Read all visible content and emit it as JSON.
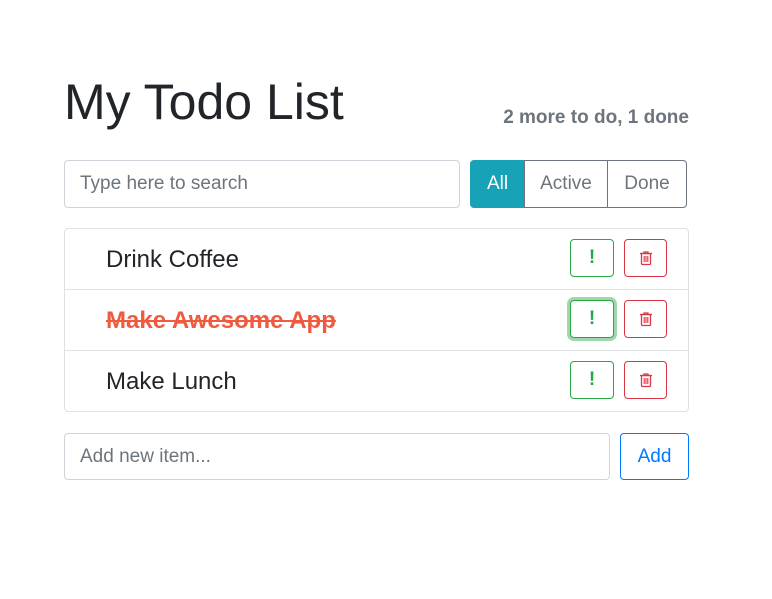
{
  "header": {
    "title": "My Todo List",
    "status": "2 more to do, 1 done"
  },
  "search": {
    "placeholder": "Type here to search",
    "value": ""
  },
  "filters": {
    "all": "All",
    "active": "Active",
    "done": "Done",
    "selected": "All"
  },
  "todos": [
    {
      "label": "Drink Coffee",
      "done": false,
      "important_label": "!",
      "delete_icon": "trash-icon"
    },
    {
      "label": "Make Awesome App",
      "done": true,
      "important_label": "!",
      "delete_icon": "trash-icon"
    },
    {
      "label": "Make Lunch",
      "done": false,
      "important_label": "!",
      "delete_icon": "trash-icon"
    }
  ],
  "add_form": {
    "placeholder": "Add new item...",
    "value": "",
    "button_label": "Add"
  },
  "colors": {
    "accent": "#17a2b8",
    "success": "#28a745",
    "danger": "#dc3545",
    "primary": "#007bff",
    "done_text": "#f05a3e",
    "muted": "#6c757d"
  }
}
